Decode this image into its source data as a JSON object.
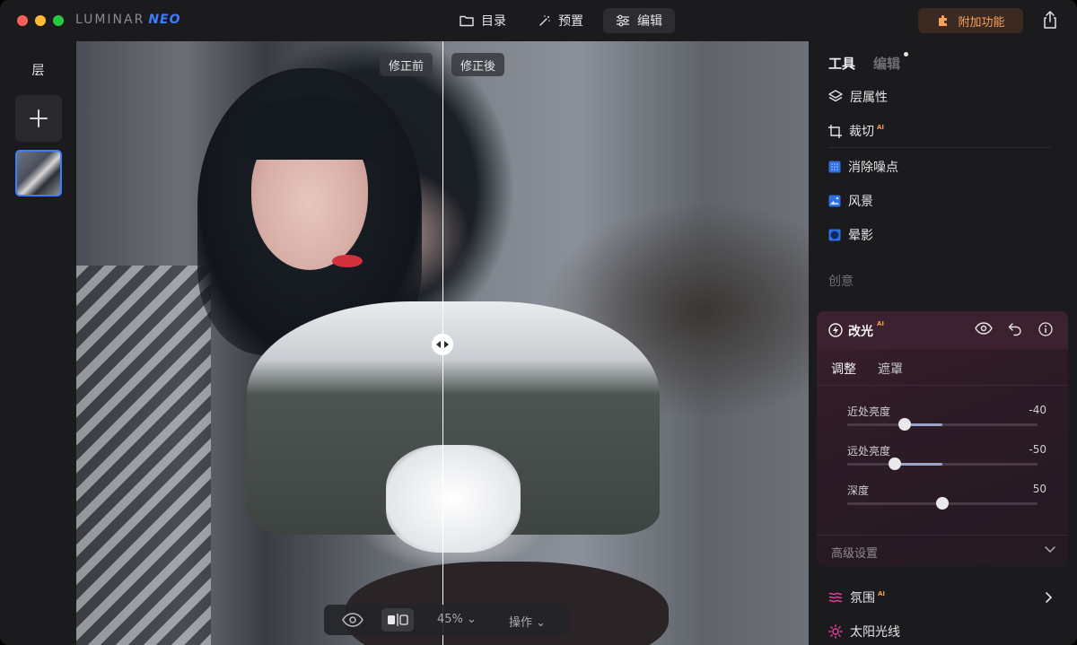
{
  "app": {
    "brand": "LUMINAR",
    "brand_suffix": "NEO"
  },
  "topnav": {
    "catalog": "目录",
    "presets": "预置",
    "edit": "编辑"
  },
  "addons_label": "附加功能",
  "layers": {
    "title": "层"
  },
  "canvas": {
    "before_label": "修正前",
    "after_label": "修正後",
    "zoom": "45%",
    "ops_label": "操作"
  },
  "tools_panel": {
    "tab_tools": "工具",
    "tab_edit": "编辑",
    "items": {
      "layer_properties": "层属性",
      "crop": "裁切",
      "crop_ai": "AI",
      "denoise": "消除噪点",
      "landscape": "风景",
      "vignette": "晕影"
    },
    "section_creative": "创意",
    "relight": {
      "title": "改光",
      "ai": "AI",
      "subtab_adjust": "调整",
      "subtab_mask": "遮罩",
      "sliders": [
        {
          "label": "近处亮度",
          "value": "-40",
          "level": 0.3
        },
        {
          "label": "远处亮度",
          "value": "-50",
          "level": 0.25
        },
        {
          "label": "深度",
          "value": "50",
          "level": 0.5
        }
      ],
      "advanced": "高级设置"
    },
    "atmosphere": "氛围",
    "atmosphere_ai": "AI",
    "sunrays": "太阳光线"
  },
  "colors": {
    "accent_blue": "#3f7dff",
    "addon_orange": "#f7a15d",
    "ai_badge": "#f39a48"
  }
}
